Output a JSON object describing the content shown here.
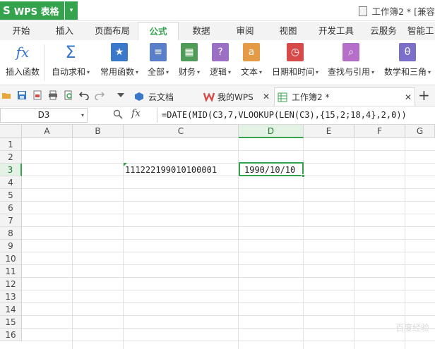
{
  "app": {
    "name": "WPS 表格",
    "logo": "S",
    "menu_arrow": "▾"
  },
  "document": {
    "title": "工作簿2 * [兼容"
  },
  "ribbon_tabs": [
    "开始",
    "插入",
    "页面布局",
    "公式",
    "数据",
    "审阅",
    "视图",
    "开发工具",
    "云服务",
    "智能工"
  ],
  "active_tab": "公式",
  "ribbon_commands": [
    {
      "label": "插入函数",
      "icon": "fx-icon",
      "color": "#3a78c9"
    },
    {
      "label": "自动求和",
      "icon": "sigma-icon",
      "color": "#3a78c9"
    },
    {
      "label": "常用函数",
      "icon": "star-book-icon",
      "color": "#3a78c9"
    },
    {
      "label": "全部",
      "icon": "book-icon",
      "color": "#5b7ec9"
    },
    {
      "label": "财务",
      "icon": "finance-book-icon",
      "color": "#4f9b57"
    },
    {
      "label": "逻辑",
      "icon": "question-book-icon",
      "color": "#9b6fc4"
    },
    {
      "label": "文本",
      "icon": "text-book-icon",
      "color": "#e59a45"
    },
    {
      "label": "日期和时间",
      "icon": "clock-book-icon",
      "color": "#d64a4a"
    },
    {
      "label": "查找与引用",
      "icon": "search-book-icon",
      "color": "#b56fc9"
    },
    {
      "label": "数学和三角",
      "icon": "theta-book-icon",
      "color": "#7c6fc9"
    }
  ],
  "doc_tabs": [
    {
      "label": "云文档",
      "icon": "cloud-doc-icon",
      "closable": false
    },
    {
      "label": "我的WPS",
      "icon": "wps-icon",
      "closable": true
    },
    {
      "label": "工作簿2 *",
      "icon": "sheet-icon",
      "closable": true,
      "active": true
    }
  ],
  "name_box": {
    "value": "D3"
  },
  "formula_bar": {
    "fx_label": "fx",
    "formula": "=DATE(MID(C3,7,VLOOKUP(LEN(C3),{15,2;18,4},2,0))"
  },
  "columns": [
    "A",
    "B",
    "C",
    "D",
    "E",
    "F",
    "G"
  ],
  "rows": [
    "1",
    "2",
    "3",
    "4",
    "5",
    "6",
    "7",
    "8",
    "9",
    "10",
    "11",
    "12",
    "13",
    "14",
    "15",
    "16"
  ],
  "selected_cell": {
    "column": "D",
    "row": "3"
  },
  "cells": {
    "C3": "111222199010100001",
    "D3": "1990/10/10"
  },
  "watermark": "百度经验"
}
